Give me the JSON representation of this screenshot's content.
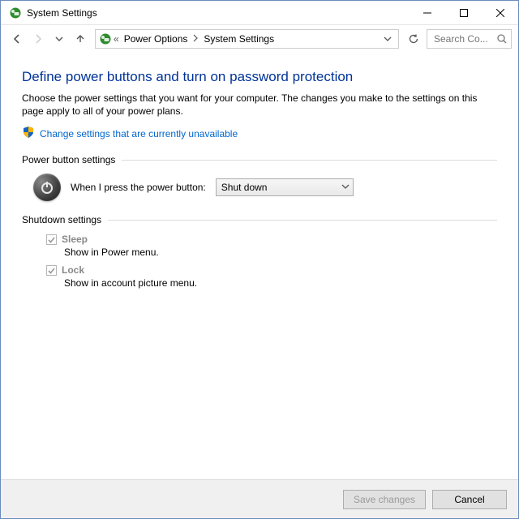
{
  "window": {
    "title": "System Settings"
  },
  "breadcrumb": {
    "item1": "Power Options",
    "item2": "System Settings"
  },
  "search": {
    "placeholder": "Search Co..."
  },
  "content": {
    "heading": "Define power buttons and turn on password protection",
    "description": "Choose the power settings that you want for your computer. The changes you make to the settings on this page apply to all of your power plans.",
    "change_link": "Change settings that are currently unavailable"
  },
  "groups": {
    "power_button": {
      "title": "Power button settings",
      "label": "When I press the power button:",
      "value": "Shut down"
    },
    "shutdown": {
      "title": "Shutdown settings",
      "sleep": {
        "label": "Sleep",
        "desc": "Show in Power menu.",
        "checked": true
      },
      "lock": {
        "label": "Lock",
        "desc": "Show in account picture menu.",
        "checked": true
      }
    }
  },
  "footer": {
    "save": "Save changes",
    "cancel": "Cancel"
  }
}
